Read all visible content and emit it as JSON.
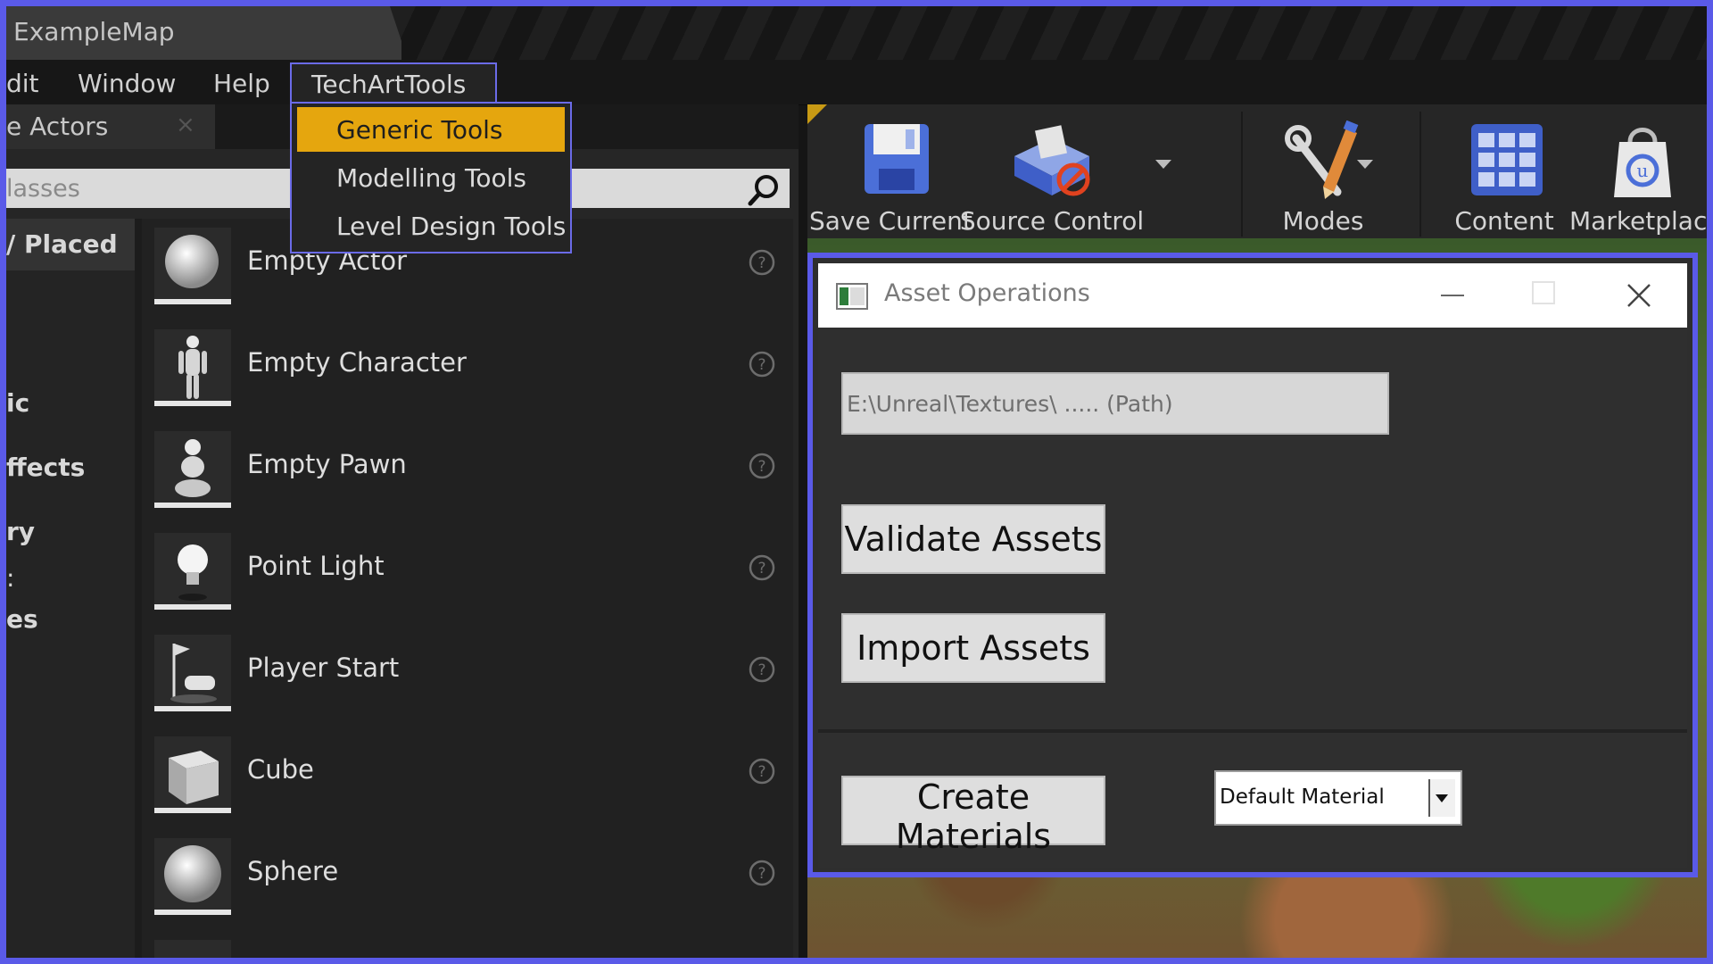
{
  "window": {
    "title": "ExampleMap"
  },
  "menubar": {
    "items": [
      "dit",
      "Window",
      "Help"
    ],
    "techart_menu": "TechArtTools"
  },
  "techart_dropdown": {
    "items": [
      {
        "label": "Generic Tools",
        "active": true
      },
      {
        "label": "Modelling Tools",
        "active": false
      },
      {
        "label": "Level Design Tools",
        "active": false
      }
    ]
  },
  "left_panel": {
    "tab_label": "e Actors",
    "tab_close": "×",
    "search_placeholder": "lasses",
    "categories": [
      "/ Placed",
      "ic",
      "ffects",
      "ry",
      ":",
      "es"
    ],
    "actors": [
      {
        "name": "Empty Actor",
        "icon": "sphere-icon"
      },
      {
        "name": "Empty Character",
        "icon": "character-icon"
      },
      {
        "name": "Empty Pawn",
        "icon": "pawn-icon"
      },
      {
        "name": "Point Light",
        "icon": "light-bulb-icon"
      },
      {
        "name": "Player Start",
        "icon": "player-start-icon"
      },
      {
        "name": "Cube",
        "icon": "cube-icon"
      },
      {
        "name": "Sphere",
        "icon": "sphere-icon"
      }
    ]
  },
  "toolbar": {
    "buttons": [
      {
        "label": "Save Current",
        "icon": "floppy-disk-icon"
      },
      {
        "label": "Source Control",
        "icon": "source-control-icon"
      },
      {
        "label": "Modes",
        "icon": "tools-icon"
      },
      {
        "label": "Content",
        "icon": "grid-icon"
      },
      {
        "label": "Marketplace",
        "icon": "marketplace-bag-icon"
      }
    ]
  },
  "asset_window": {
    "title": "Asset Operations",
    "path_placeholder": "E:\\Unreal\\Textures\\ ..... (Path)",
    "validate_label": "Validate Assets",
    "import_label": "Import Assets",
    "create_label": "Create Materials",
    "material_select": "Default Material"
  },
  "colors": {
    "accent": "#5a5ae8",
    "menu_highlight": "#e5a60e"
  }
}
